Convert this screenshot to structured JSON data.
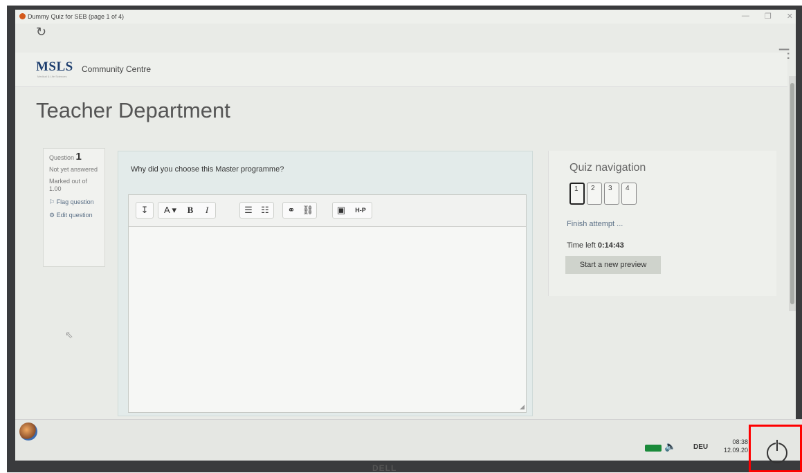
{
  "window": {
    "title": "Dummy Quiz for SEB (page 1 of 4)",
    "minimize": "—",
    "maximize": "❐",
    "close": "✕"
  },
  "header": {
    "logo": "MSLS",
    "logo_sub": "Medical & Life Sciences",
    "site_name": "Community Centre"
  },
  "page": {
    "heading": "Teacher Department"
  },
  "question_info": {
    "label": "Question",
    "number": "1",
    "status": "Not yet answered",
    "marks": "Marked out of 1.00",
    "flag": "Flag question",
    "edit": "Edit question"
  },
  "question": {
    "text": "Why did you choose this Master programme?",
    "toolbar": {
      "collapse": "↧",
      "font": "A ▾",
      "bold": "B",
      "italic": "I",
      "ul": "☰",
      "ol": "☷",
      "link": "⚭",
      "unlink": "⛓",
      "image": "▣",
      "h5p": "H-P"
    }
  },
  "quiz_nav": {
    "title": "Quiz navigation",
    "buttons": [
      "1",
      "2",
      "3",
      "4"
    ],
    "finish": "Finish attempt ...",
    "time_label": "Time left",
    "time_value": "0:14:43",
    "preview": "Start a new preview"
  },
  "taskbar": {
    "language": "DEU",
    "time": "08:38",
    "date": "12.09.20"
  },
  "monitor": {
    "brand": "DELL"
  }
}
